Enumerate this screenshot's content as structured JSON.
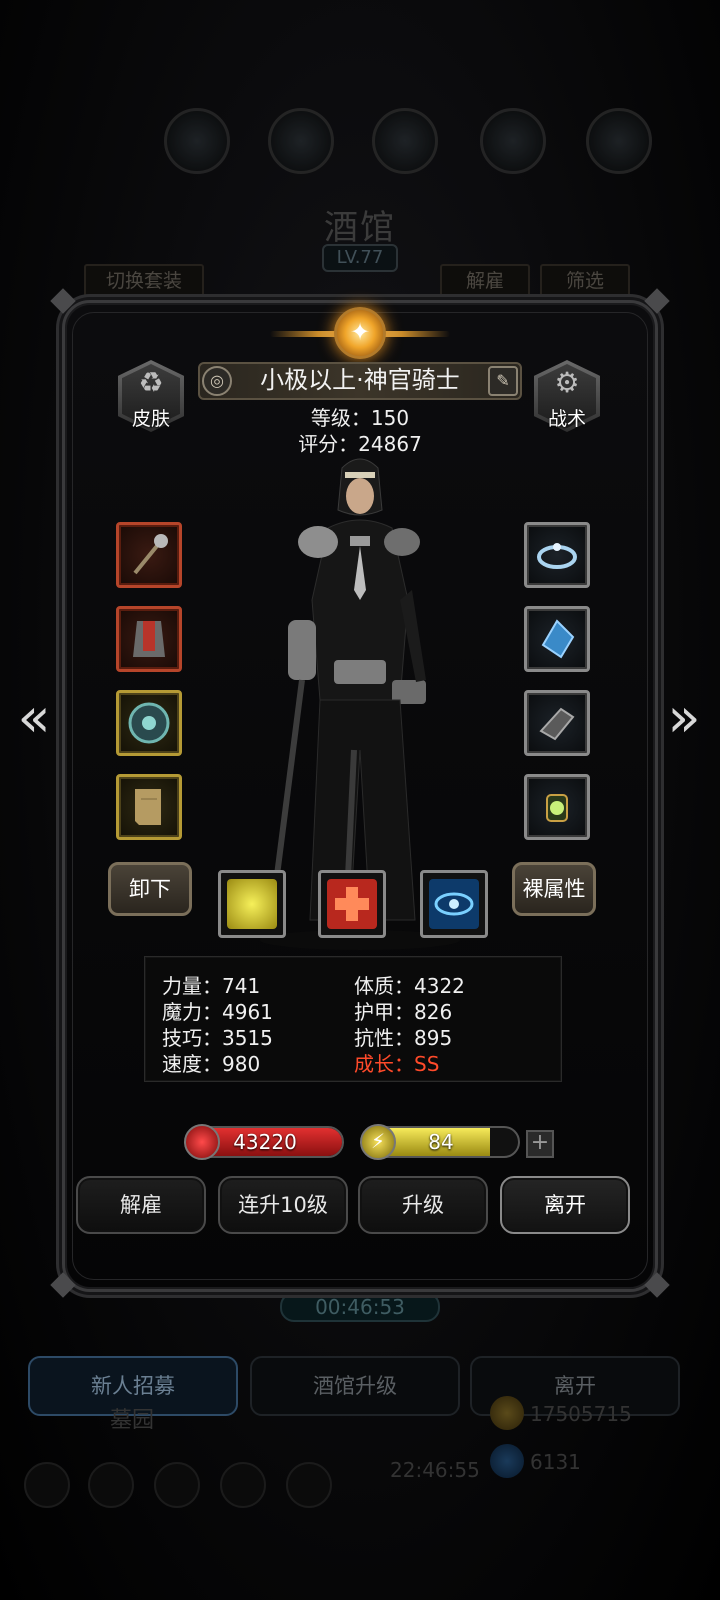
{
  "background": {
    "title": "酒馆",
    "level": "LV.77",
    "left_tab": "切换套装",
    "right_tabs": [
      "解雇",
      "筛选"
    ],
    "timer": "00:46:53",
    "bottom_buttons": [
      "新人招募",
      "酒馆升级",
      "离开"
    ],
    "cemetery": "墓园",
    "clock": "22:46:55",
    "gold": "17505715",
    "gems": "6131"
  },
  "hero": {
    "name": "小极以上·神官骑士",
    "level_text": "等级：150",
    "score_text": "评分：24867"
  },
  "side_buttons": {
    "skin": "皮肤",
    "tactics": "战术"
  },
  "equipment": {
    "left": [
      "mace-icon",
      "armor-icon",
      "shield-icon",
      "scroll-icon"
    ],
    "right": [
      "crown-icon",
      "crystal-icon",
      "gauntlet-icon",
      "lantern-icon"
    ]
  },
  "controls": {
    "unequip": "卸下",
    "naked_attributes": "裸属性"
  },
  "skills": [
    "fist-icon",
    "heal-cross-icon",
    "eye-icon"
  ],
  "attributes": {
    "strength": "力量：741",
    "magic": "魔力：4961",
    "skill": "技巧：3515",
    "speed": "速度：980",
    "constitution": "体质：4322",
    "armor": "护甲：826",
    "resistance": "抗性：895",
    "growth": "成长：SS"
  },
  "bars": {
    "hp": "43220",
    "energy": "84",
    "energy_fill": 0.82
  },
  "actions": [
    "解雇",
    "连升10级",
    "升级",
    "离开"
  ],
  "colors": {
    "growth": "#ff4a2a",
    "hp": "#c41a1a",
    "energy": "#e6d43a"
  }
}
